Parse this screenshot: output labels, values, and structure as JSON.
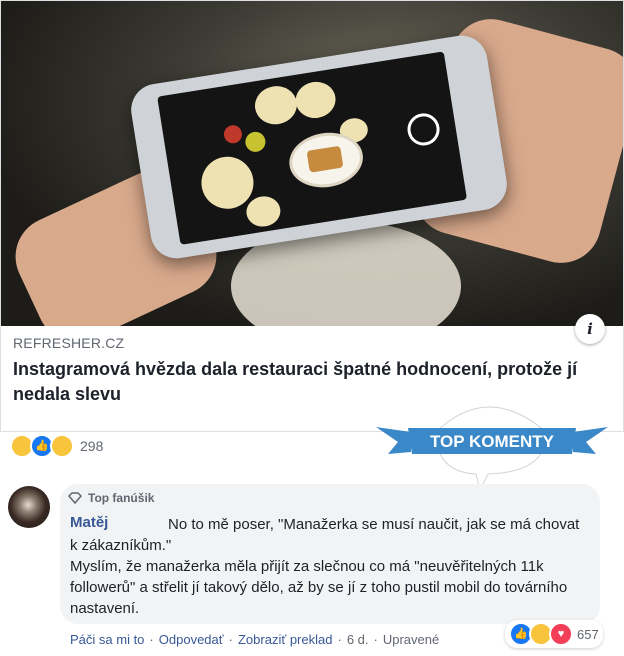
{
  "post": {
    "source": "REFRESHER.CZ",
    "info_icon": "i",
    "headline": "Instagramová hvězda dala restauraci špatné hodnocení, protože jí nedala slevu",
    "reaction_icons": [
      "haha-icon",
      "like-icon",
      "sad-icon"
    ],
    "reaction_count": "298"
  },
  "banner": {
    "text": "TOP KOMENTY",
    "color": "#3a88c8"
  },
  "comment": {
    "badge": "Top fanúšik",
    "author": "Matěj",
    "text_line1": "No to mě poser, \"Manažerka se musí naučit, jak se má chovat k zákazníkům.\"",
    "text_line2": "Myslím, že manažerka měla přijít za slečnou co má \"neuvěřitelných 11k followerů\" a střelit jí takový dělo, až by se jí z toho pustil mobil do továrního nastavení.",
    "actions": {
      "like": "Páči sa mi to",
      "reply": "Odpovedať",
      "translate": "Zobraziť preklad",
      "age": "6 d.",
      "edited": "Upravené"
    },
    "reaction_icons": [
      "like-icon",
      "haha-icon",
      "love-icon"
    ],
    "reaction_count": "657"
  },
  "colors": {
    "link": "#385898",
    "accent": "#1877f2"
  }
}
